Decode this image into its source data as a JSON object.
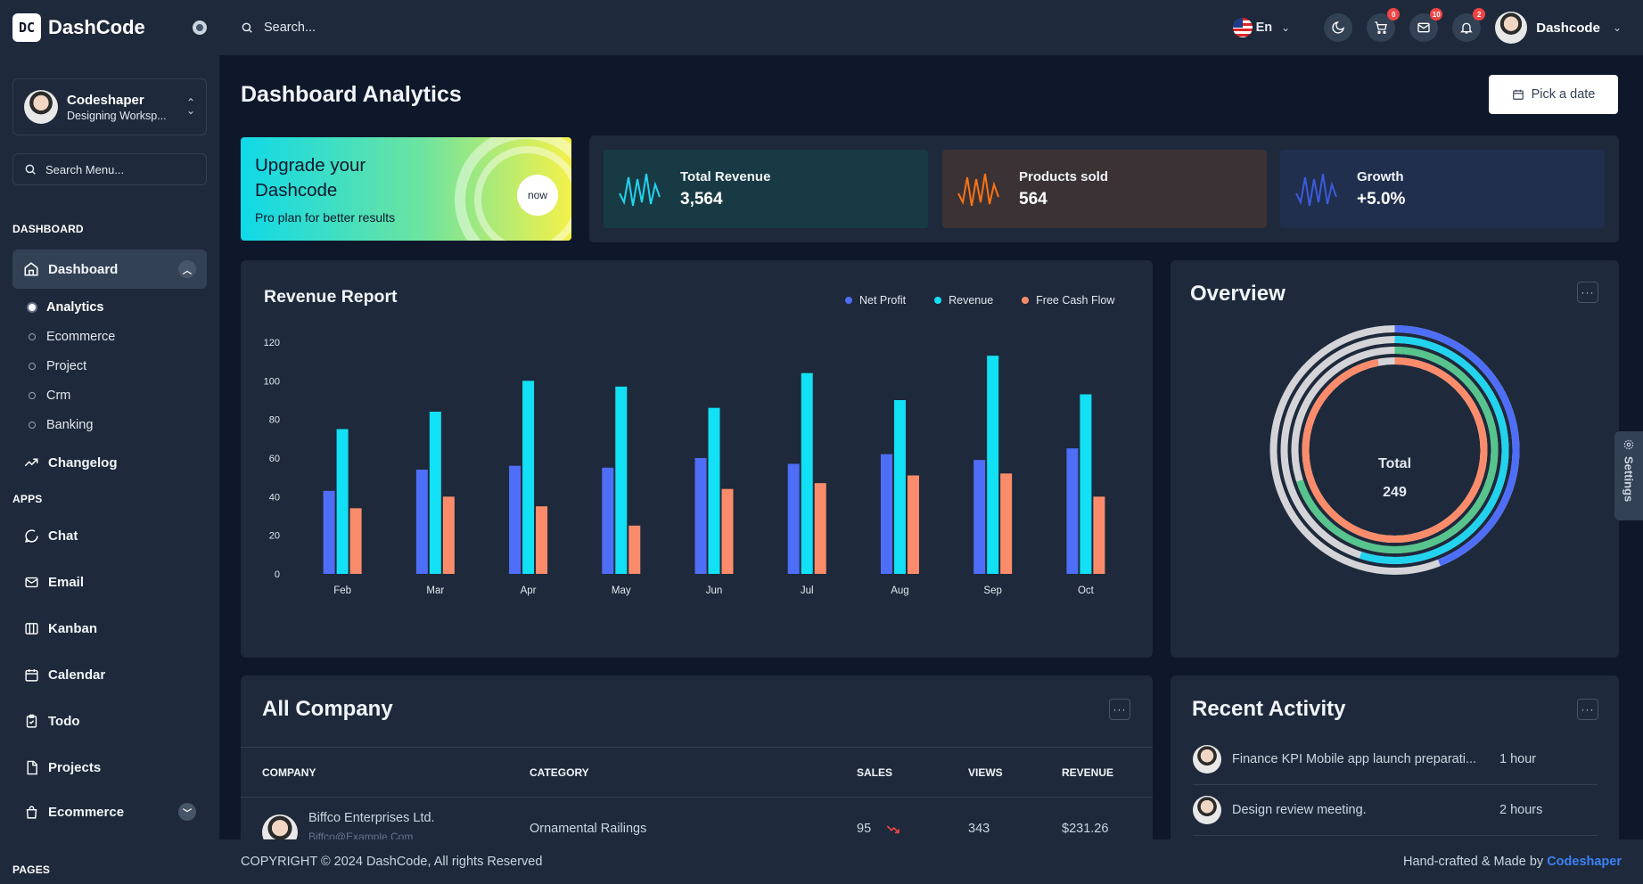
{
  "brand": {
    "logo": "DC",
    "name": "DashCode"
  },
  "user_card": {
    "name": "Codeshaper",
    "subtitle": "Designing Worksp..."
  },
  "sidebar": {
    "search_placeholder": "Search Menu...",
    "section_dashboard": "DASHBOARD",
    "dashboard_label": "Dashboard",
    "sub_items": [
      "Analytics",
      "Ecommerce",
      "Project",
      "Crm",
      "Banking"
    ],
    "changelog": "Changelog",
    "section_apps": "APPS",
    "apps": [
      "Chat",
      "Email",
      "Kanban",
      "Calendar",
      "Todo",
      "Projects",
      "Ecommerce"
    ],
    "section_pages": "PAGES"
  },
  "header": {
    "search_placeholder": "Search...",
    "language": "En",
    "cart_badge": "0",
    "mail_badge": "10",
    "notif_badge": "2",
    "profile_name": "Dashcode"
  },
  "page": {
    "title": "Dashboard Analytics",
    "date_button": "Pick a date"
  },
  "upgrade": {
    "title": "Upgrade your Dashcode",
    "subtitle": "Pro plan for better results",
    "button": "now"
  },
  "stats": [
    {
      "label": "Total Revenue",
      "value": "3,564",
      "color": "#22d3ee",
      "bg": "#183a44"
    },
    {
      "label": "Products sold",
      "value": "564",
      "color": "#f97316",
      "bg": "#3a3234"
    },
    {
      "label": "Growth",
      "value": "+5.0%",
      "color": "#3b5bdb",
      "bg": "#1f2f4d"
    }
  ],
  "revenue_report": {
    "title": "Revenue Report"
  },
  "chart_data": {
    "type": "bar",
    "categories": [
      "Feb",
      "Mar",
      "Apr",
      "May",
      "Jun",
      "Jul",
      "Aug",
      "Sep",
      "Oct"
    ],
    "series": [
      {
        "name": "Net Profit",
        "color": "#4f6ef7",
        "values": [
          43,
          54,
          56,
          55,
          60,
          57,
          62,
          59,
          65
        ]
      },
      {
        "name": "Revenue",
        "color": "#12e0f5",
        "values": [
          75,
          84,
          100,
          97,
          86,
          104,
          90,
          113,
          93
        ]
      },
      {
        "name": "Free Cash Flow",
        "color": "#fb8c6b",
        "values": [
          34,
          40,
          35,
          25,
          44,
          47,
          51,
          52,
          40
        ]
      }
    ],
    "yticks": [
      0,
      20,
      40,
      60,
      80,
      100,
      120
    ],
    "ylim": [
      0,
      120
    ],
    "legend": "top-right"
  },
  "overview": {
    "title": "Overview",
    "total_label": "Total",
    "total_value": "249",
    "rings": [
      {
        "color": "#4f6ef7",
        "fraction": 0.44
      },
      {
        "color": "#22d3ee",
        "fraction": 0.55
      },
      {
        "color": "#56c48c",
        "fraction": 0.7
      },
      {
        "color": "#fb8c6b",
        "fraction": 0.97
      }
    ]
  },
  "company": {
    "title": "All Company",
    "headers": [
      "COMPANY",
      "CATEGORY",
      "SALES",
      "VIEWS",
      "REVENUE"
    ],
    "row": {
      "name": "Biffco Enterprises Ltd.",
      "email": "Biffco@Example.Com",
      "category": "Ornamental Railings",
      "sales": "95",
      "views": "343",
      "revenue": "$231.26"
    }
  },
  "activity": {
    "title": "Recent Activity",
    "items": [
      {
        "text": "Finance KPI Mobile app launch preparati...",
        "time": "1 hour"
      },
      {
        "text": "Design review meeting.",
        "time": "2 hours"
      }
    ]
  },
  "footer": {
    "copyright": "COPYRIGHT © 2024 DashCode, All rights Reserved",
    "made_by": "Hand-crafted & Made by",
    "made_by_brand": "Codeshaper"
  },
  "settings_tab": "Settings"
}
